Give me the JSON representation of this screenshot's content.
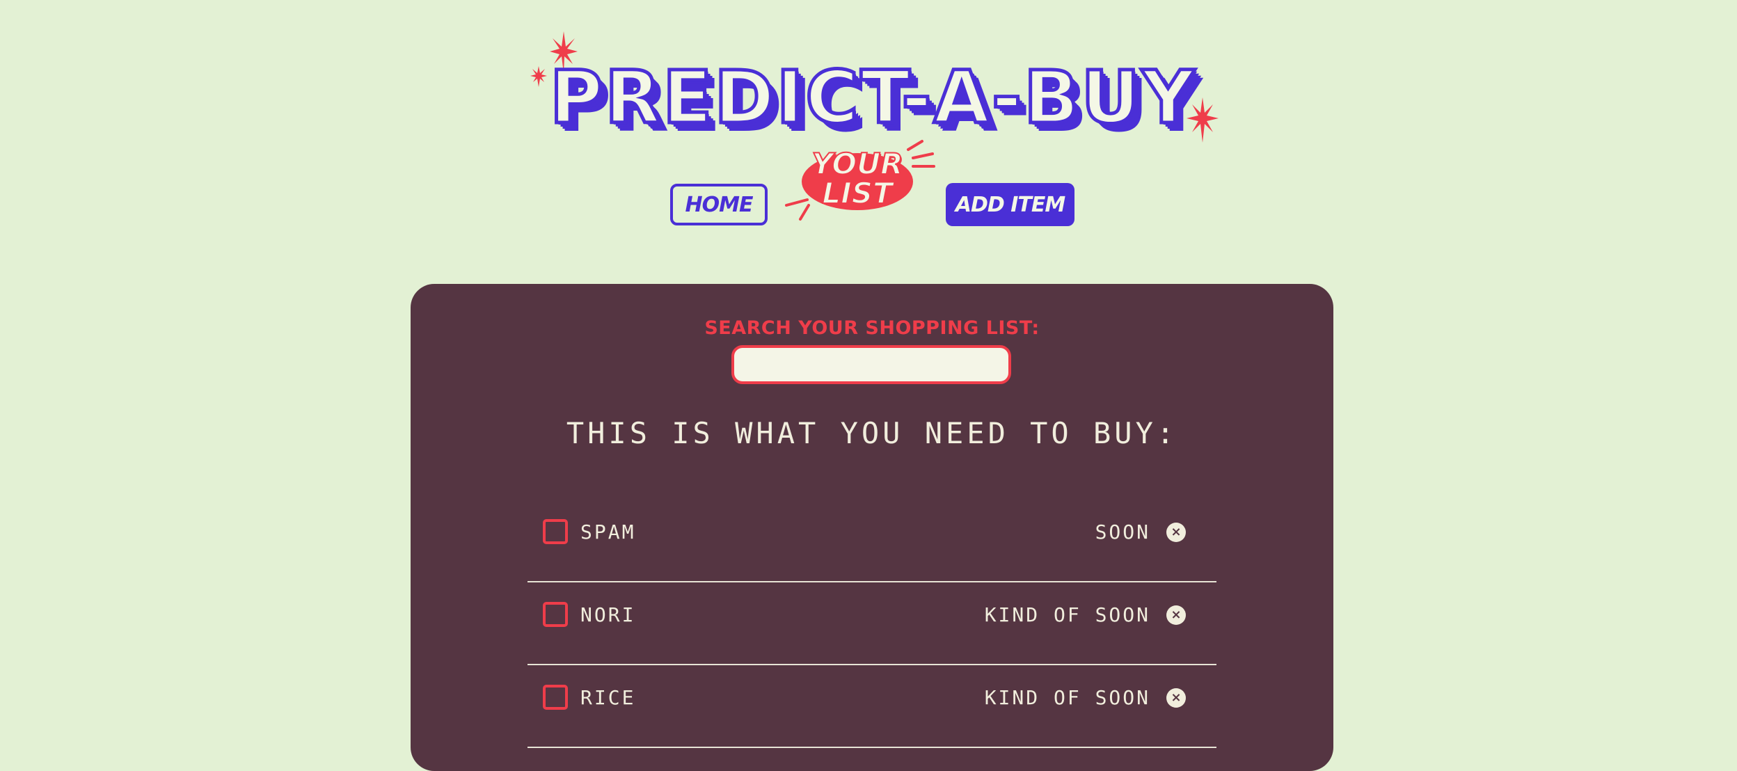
{
  "app": {
    "title": "PREDICT-A-BUY"
  },
  "nav": {
    "home_label": "HOME",
    "your_list_line1": "YOUR",
    "your_list_line2": "LIST",
    "add_item_label": "ADD ITEM"
  },
  "search": {
    "label": "SEARCH YOUR SHOPPING LIST:",
    "value": "",
    "placeholder": ""
  },
  "list": {
    "heading": "THIS IS WHAT YOU NEED TO BUY:",
    "items": [
      {
        "name": "SPAM",
        "urgency": "SOON",
        "checked": false
      },
      {
        "name": "NORI",
        "urgency": "KIND OF SOON",
        "checked": false
      },
      {
        "name": "RICE",
        "urgency": "KIND OF SOON",
        "checked": false
      }
    ]
  },
  "icons": {
    "sparkle": "sparkle-icon",
    "delete": "close-circle-icon"
  },
  "colors": {
    "background": "#e3f1d4",
    "brand_purple": "#4a2fd6",
    "accent_red": "#ef3d4a",
    "panel": "#553542",
    "cream": "#f1eedd"
  }
}
